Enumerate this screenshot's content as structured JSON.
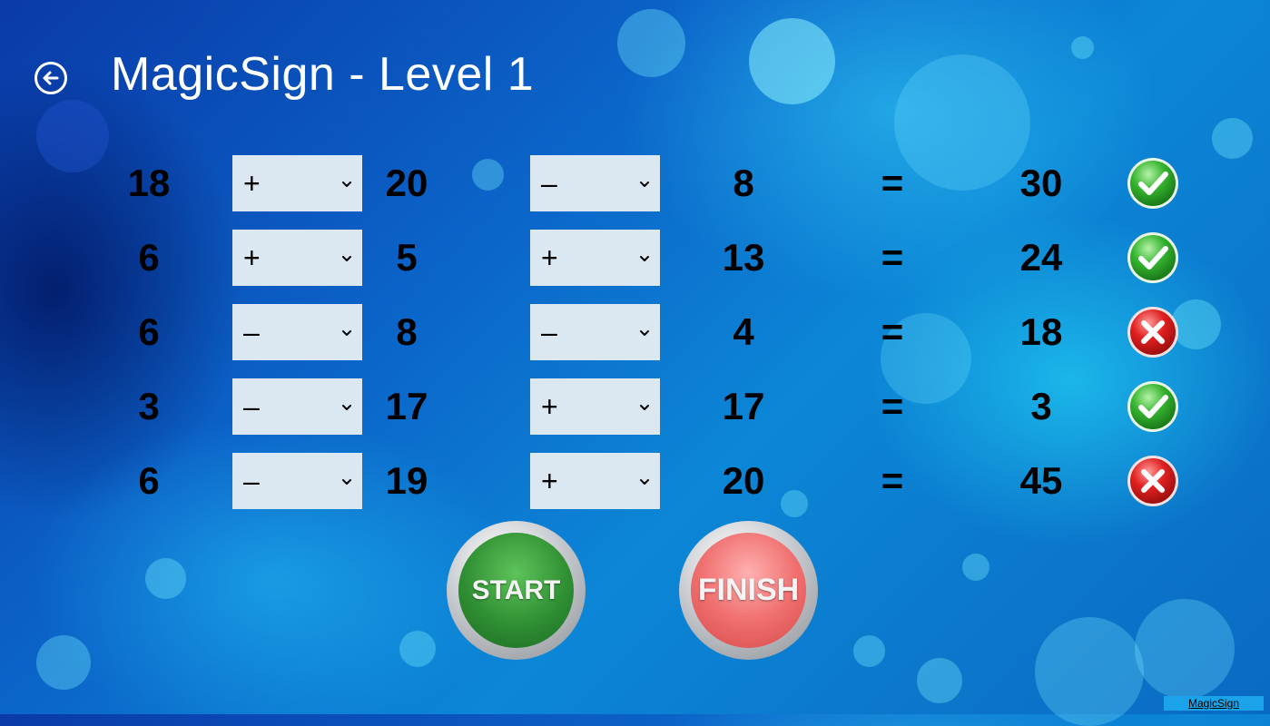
{
  "header": {
    "title": "MagicSign - Level 1",
    "back_icon": "back-arrow-icon"
  },
  "rows": [
    {
      "a": "18",
      "op1": "+",
      "b": "20",
      "op2": "–",
      "c": "8",
      "eq": "=",
      "result": "30",
      "status": "correct"
    },
    {
      "a": "6",
      "op1": "+",
      "b": "5",
      "op2": "+",
      "c": "13",
      "eq": "=",
      "result": "24",
      "status": "correct"
    },
    {
      "a": "6",
      "op1": "–",
      "b": "8",
      "op2": "–",
      "c": "4",
      "eq": "=",
      "result": "18",
      "status": "wrong"
    },
    {
      "a": "3",
      "op1": "–",
      "b": "17",
      "op2": "+",
      "c": "17",
      "eq": "=",
      "result": "3",
      "status": "correct"
    },
    {
      "a": "6",
      "op1": "–",
      "b": "19",
      "op2": "+",
      "c": "20",
      "eq": "=",
      "result": "45",
      "status": "wrong"
    }
  ],
  "buttons": {
    "start_label": "START",
    "finish_label": "FINISH"
  },
  "footer": {
    "app_tag": "MagicSign"
  },
  "colors": {
    "correct": "#2fb52f",
    "wrong": "#e02020",
    "select_bg": "#dce8f1"
  }
}
